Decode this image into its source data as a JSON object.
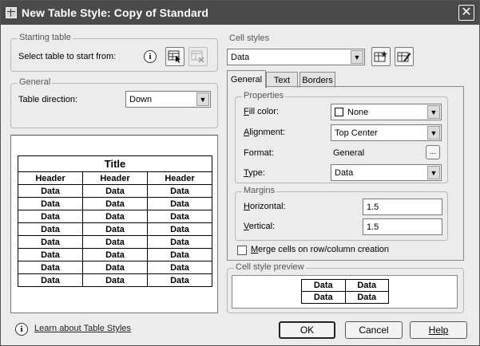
{
  "window": {
    "title": "New Table Style: Copy of Standard",
    "close_glyph": "✕"
  },
  "starting_table": {
    "label": "Starting table",
    "select_label": "Select table to start from:",
    "info_glyph": "i"
  },
  "general": {
    "label": "General",
    "direction_label": "Table direction:",
    "direction_value": "Down"
  },
  "preview_table": {
    "title": "Title",
    "headers": [
      "Header",
      "Header",
      "Header"
    ],
    "rows": [
      [
        "Data",
        "Data",
        "Data"
      ],
      [
        "Data",
        "Data",
        "Data"
      ],
      [
        "Data",
        "Data",
        "Data"
      ],
      [
        "Data",
        "Data",
        "Data"
      ],
      [
        "Data",
        "Data",
        "Data"
      ],
      [
        "Data",
        "Data",
        "Data"
      ],
      [
        "Data",
        "Data",
        "Data"
      ],
      [
        "Data",
        "Data",
        "Data"
      ]
    ]
  },
  "cell_styles": {
    "label": "Cell styles",
    "selected": "Data",
    "tabs": [
      "General",
      "Text",
      "Borders"
    ],
    "active_tab": "General"
  },
  "properties": {
    "label": "Properties",
    "fill_color_label": "Fill color:",
    "fill_color_value": "None",
    "alignment_label": "Alignment:",
    "alignment_value": "Top Center",
    "format_label": "Format:",
    "format_value": "General",
    "format_button": "...",
    "type_label": "Type:",
    "type_value": "Data"
  },
  "margins": {
    "label": "Margins",
    "horizontal_label": "Horizontal:",
    "horizontal_value": "1.5",
    "vertical_label": "Vertical:",
    "vertical_value": "1.5"
  },
  "merge": {
    "label": "Merge cells on row/column creation",
    "checked": false
  },
  "cell_style_preview": {
    "label": "Cell style preview",
    "cells": [
      [
        "Data",
        "Data"
      ],
      [
        "Data",
        "Data"
      ]
    ]
  },
  "footer": {
    "learn_link": "Learn about Table Styles",
    "ok": "OK",
    "cancel": "Cancel",
    "help": "Help"
  }
}
